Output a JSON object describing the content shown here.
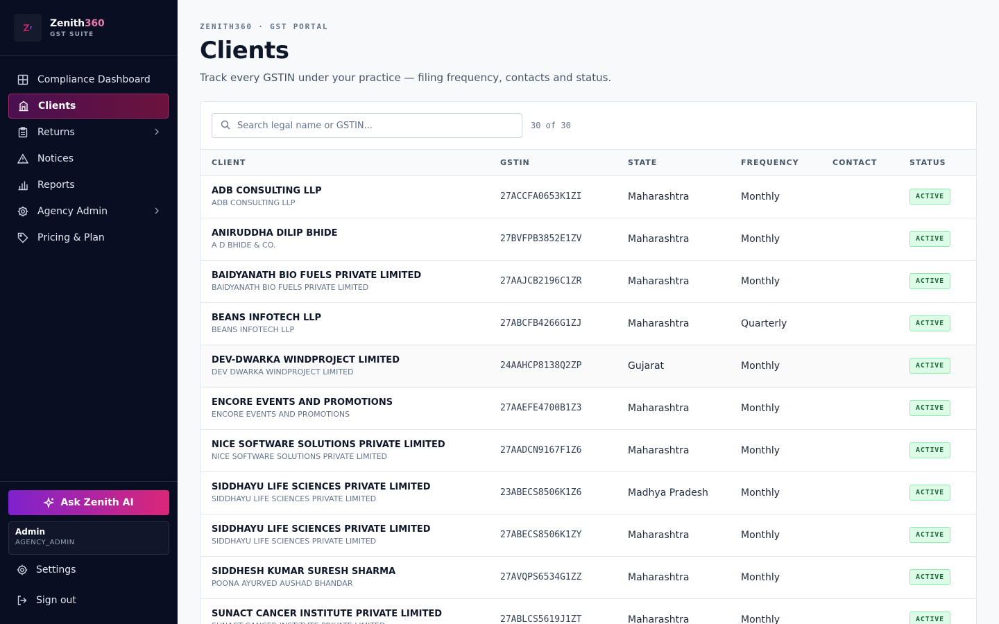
{
  "brand": {
    "name": "Zenith",
    "name_accent": "360",
    "subtitle": "GST SUITE"
  },
  "nav": {
    "items": [
      {
        "label": "Compliance Dashboard",
        "icon": "grid-icon"
      },
      {
        "label": "Clients",
        "icon": "building-icon",
        "active": true
      },
      {
        "label": "Returns",
        "icon": "clipboard-icon",
        "chevron": true
      },
      {
        "label": "Notices",
        "icon": "warning-icon"
      },
      {
        "label": "Reports",
        "icon": "bar-chart-icon"
      },
      {
        "label": "Agency Admin",
        "icon": "gear-icon",
        "chevron": true
      },
      {
        "label": "Pricing & Plan",
        "icon": "tag-icon"
      }
    ]
  },
  "sidebar_bottom": {
    "ask_label": "Ask Zenith AI",
    "user_name": "Admin",
    "user_role": "AGENCY_ADMIN",
    "settings_label": "Settings",
    "signout_label": "Sign out"
  },
  "header": {
    "eyebrow": "ZENITH360 · GST PORTAL",
    "title": "Clients",
    "subtitle": "Track every GSTIN under your practice — filing frequency, contacts and status."
  },
  "search": {
    "placeholder": "Search legal name or GSTIN...",
    "count": "30 of 30"
  },
  "table": {
    "columns": [
      "CLIENT",
      "GSTIN",
      "STATE",
      "FREQUENCY",
      "CONTACT",
      "STATUS"
    ],
    "rows": [
      {
        "name": "ADB CONSULTING LLP",
        "legal": "ADB CONSULTING LLP",
        "gstin": "27ACCFA0653K1ZI",
        "state": "Maharashtra",
        "frequency": "Monthly",
        "contact": "",
        "status": "ACTIVE"
      },
      {
        "name": "ANIRUDDHA DILIP BHIDE",
        "legal": "A D BHIDE & CO.",
        "gstin": "27BVFPB3852E1ZV",
        "state": "Maharashtra",
        "frequency": "Monthly",
        "contact": "",
        "status": "ACTIVE"
      },
      {
        "name": "BAIDYANATH BIO FUELS PRIVATE LIMITED",
        "legal": "BAIDYANATH BIO FUELS PRIVATE LIMITED",
        "gstin": "27AAJCB2196C1ZR",
        "state": "Maharashtra",
        "frequency": "Monthly",
        "contact": "",
        "status": "ACTIVE"
      },
      {
        "name": "BEANS INFOTECH LLP",
        "legal": "BEANS INFOTECH LLP",
        "gstin": "27ABCFB4266G1ZJ",
        "state": "Maharashtra",
        "frequency": "Quarterly",
        "contact": "",
        "status": "ACTIVE"
      },
      {
        "name": "DEV-DWARKA WINDPROJECT LIMITED",
        "legal": "DEV DWARKA WINDPROJECT LIMITED",
        "gstin": "24AAHCP8138Q2ZP",
        "state": "Gujarat",
        "frequency": "Monthly",
        "contact": "",
        "status": "ACTIVE"
      },
      {
        "name": "ENCORE EVENTS AND PROMOTIONS",
        "legal": "ENCORE EVENTS AND PROMOTIONS",
        "gstin": "27AAEFE4700B1Z3",
        "state": "Maharashtra",
        "frequency": "Monthly",
        "contact": "",
        "status": "ACTIVE"
      },
      {
        "name": "NICE SOFTWARE SOLUTIONS PRIVATE LIMITED",
        "legal": "NICE SOFTWARE SOLUTIONS PRIVATE LIMITED",
        "gstin": "27AADCN9167F1Z6",
        "state": "Maharashtra",
        "frequency": "Monthly",
        "contact": "",
        "status": "ACTIVE"
      },
      {
        "name": "SIDDHAYU LIFE SCIENCES PRIVATE LIMITED",
        "legal": "SIDDHAYU LIFE SCIENCES PRIVATE LIMITED",
        "gstin": "23ABECS8506K1Z6",
        "state": "Madhya Pradesh",
        "frequency": "Monthly",
        "contact": "",
        "status": "ACTIVE"
      },
      {
        "name": "SIDDHAYU LIFE SCIENCES PRIVATE LIMITED",
        "legal": "SIDDHAYU LIFE SCIENCES PRIVATE LIMITED",
        "gstin": "27ABECS8506K1ZY",
        "state": "Maharashtra",
        "frequency": "Monthly",
        "contact": "",
        "status": "ACTIVE"
      },
      {
        "name": "SIDDHESH KUMAR SURESH SHARMA",
        "legal": "POONA AYURVED AUSHAD BHANDAR",
        "gstin": "27AVQPS6534G1ZZ",
        "state": "Maharashtra",
        "frequency": "Monthly",
        "contact": "",
        "status": "ACTIVE"
      },
      {
        "name": "SUNACT CANCER INSTITUTE PRIVATE LIMITED",
        "legal": "SUNACT CANCER INSTITUTE PRIVATE LIMITED",
        "gstin": "27ABLCS5619J1ZT",
        "state": "Maharashtra",
        "frequency": "Monthly",
        "contact": "",
        "status": "ACTIVE"
      }
    ]
  }
}
